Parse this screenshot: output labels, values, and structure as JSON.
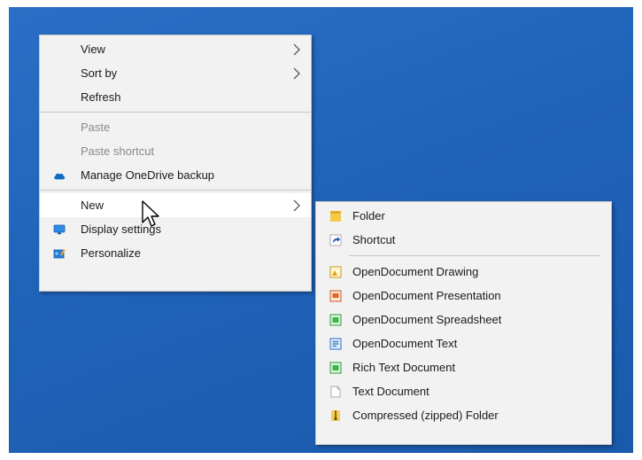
{
  "context_menu": {
    "items": [
      {
        "label": "View",
        "has_submenu": true
      },
      {
        "label": "Sort by",
        "has_submenu": true
      },
      {
        "label": "Refresh"
      },
      {
        "label": "Paste",
        "disabled": true
      },
      {
        "label": "Paste shortcut",
        "disabled": true
      },
      {
        "label": "Manage OneDrive backup",
        "icon": "onedrive-cloud-icon"
      },
      {
        "label": "New",
        "has_submenu": true,
        "highlighted": true
      },
      {
        "label": "Display settings",
        "icon": "display-settings-icon"
      },
      {
        "label": "Personalize",
        "icon": "personalize-icon"
      }
    ]
  },
  "new_submenu": {
    "items": [
      {
        "label": "Folder",
        "icon": "folder-icon"
      },
      {
        "label": "Shortcut",
        "icon": "shortcut-icon"
      },
      {
        "label": "OpenDocument Drawing",
        "icon": "odg-drawing-icon"
      },
      {
        "label": "OpenDocument Presentation",
        "icon": "odp-presentation-icon"
      },
      {
        "label": "OpenDocument Spreadsheet",
        "icon": "ods-spreadsheet-icon"
      },
      {
        "label": "OpenDocument Text",
        "icon": "odt-text-icon"
      },
      {
        "label": "Rich Text Document",
        "icon": "rtf-document-icon"
      },
      {
        "label": "Text Document",
        "icon": "text-document-icon"
      },
      {
        "label": "Compressed (zipped) Folder",
        "icon": "zip-folder-icon"
      }
    ]
  },
  "colors": {
    "desktop": "#1f63b9",
    "menu_bg": "#f2f2f2",
    "highlight": "#ffffff",
    "disabled_text": "#8a8a8a"
  }
}
